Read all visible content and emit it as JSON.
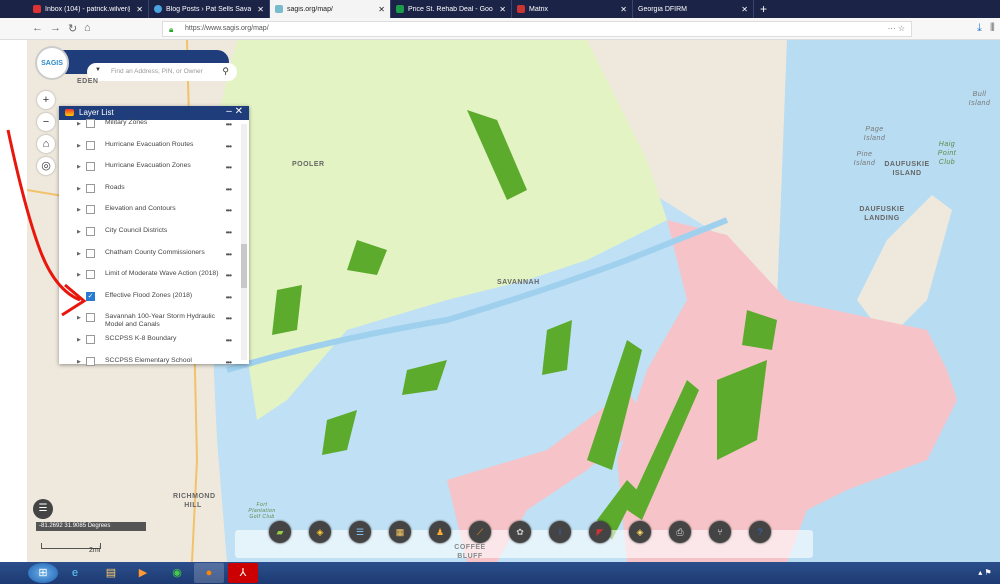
{
  "browser": {
    "tabs": [
      {
        "title": "Inbox (104) - patrick.wilver@vc",
        "icon": "gmail-icon",
        "color": "#d33"
      },
      {
        "title": "Blog Posts › Pat Sells Savannah",
        "icon": "wordpress-icon",
        "color": "#4aa3df"
      },
      {
        "title": "sagis.org/map/",
        "icon": "sagis-icon",
        "color": "#7bc",
        "active": true
      },
      {
        "title": "Price St. Rehab Deal - Google S",
        "icon": "sheets-icon",
        "color": "#1a9c4a"
      },
      {
        "title": "Matrix",
        "icon": "matrix-icon",
        "color": "#c33"
      },
      {
        "title": "Georgia DFIRM",
        "icon": "",
        "color": "#1b2347"
      }
    ],
    "url_prefix": "https://www.",
    "url": "https://www.sagis.org/map/"
  },
  "search": {
    "logo": "SAGIS",
    "placeholder": "Find an Address, PIN, or Owner"
  },
  "layer_list": {
    "title": "Layer List",
    "layers": [
      {
        "name": "Military Zones",
        "checked": false
      },
      {
        "name": "Hurricane Evacuation Routes",
        "checked": false
      },
      {
        "name": "Hurricane Evacuation Zones",
        "checked": false
      },
      {
        "name": "Roads",
        "checked": false
      },
      {
        "name": "Elevation and Contours",
        "checked": false
      },
      {
        "name": "City Council Districts",
        "checked": false
      },
      {
        "name": "Chatham County Commissioners",
        "checked": false
      },
      {
        "name": "Limit of Moderate Wave Action (2018)",
        "checked": false
      },
      {
        "name": "Effective Flood Zones (2018)",
        "checked": true
      },
      {
        "name": "Savannah 100-Year Storm Hydraulic Model and Canals",
        "checked": false
      },
      {
        "name": "SCCPSS K-8 Boundary",
        "checked": false
      },
      {
        "name": "SCCPSS Elementary School",
        "checked": false
      }
    ]
  },
  "map": {
    "coordinates": "-81.2692 31.9085 Degrees",
    "scale": "2mi",
    "labels": {
      "eden": "EDEN",
      "richmond_hill": "RICHMOND HILL",
      "daufuskie_island": "DAUFUSKIE ISLAND",
      "daufuskie_landing": "DAUFUSKIE LANDING",
      "bull_island": "Bull Island",
      "page_island": "Page Island",
      "pine_island": "Pine Island",
      "haig_point": "Haig Point Club",
      "savannah": "SAVANNAH",
      "pooler": "POOLER",
      "coffee_bluff": "COFFEE BLUFF",
      "fort_plantation": "Fort Plantation Golf Club"
    },
    "colors": {
      "land": "#efe9dd",
      "water": "#b8dcf2",
      "zone_x": "#e3f3c4",
      "zone_ae": "#bfe0f5",
      "zone_ve": "#f6c4c8",
      "wetland": "#5cab2c"
    }
  },
  "toolbar": {
    "tools": [
      "basemap-gallery",
      "layer-list",
      "legend",
      "overview",
      "streetview",
      "measurement",
      "draw",
      "about",
      "bookmark",
      "add-data",
      "print",
      "share",
      "help"
    ]
  }
}
